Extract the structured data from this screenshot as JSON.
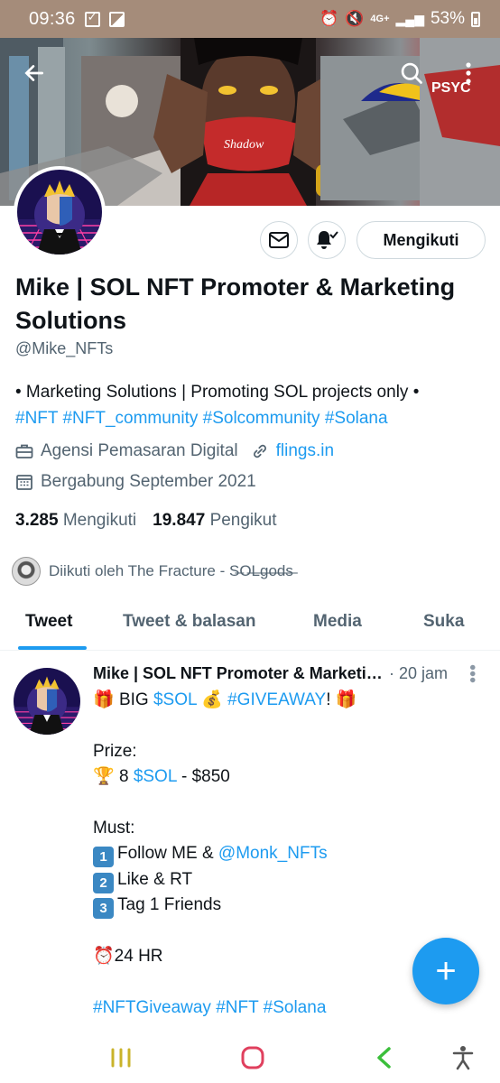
{
  "status_bar": {
    "time": "09:36",
    "network": "4G+",
    "battery": "53%"
  },
  "header": {
    "back_icon": "arrow-left-icon",
    "search_icon": "search-icon",
    "more_icon": "more-vertical-icon"
  },
  "profile": {
    "name": "Mike | SOL NFT Promoter & Marketing Solutions",
    "handle": "@Mike_NFTs",
    "follow_label": "Mengikuti",
    "bio_line1": "• Marketing Solutions | Promoting SOL projects only •",
    "bio_tags": [
      "#NFT",
      "#NFT_community",
      "#Solcommunity",
      "#Solana"
    ],
    "category": "Agensi Pemasaran Digital",
    "website": "flings.in",
    "joined": "Bergabung September 2021",
    "following_count": "3.285",
    "following_label": "Mengikuti",
    "followers_count": "19.847",
    "followers_label": "Pengikut",
    "followed_by": "Diikuti oleh The Fracture - S̶O̶L̶g̶o̶d̶s̶"
  },
  "tabs": [
    {
      "label": "Tweet",
      "active": true
    },
    {
      "label": "Tweet & balasan",
      "active": false
    },
    {
      "label": "Media",
      "active": false
    },
    {
      "label": "Suka",
      "active": false
    }
  ],
  "tweet": {
    "author": "Mike | SOL NFT Promoter & Marketing Solutions",
    "time": "· 20 jam",
    "line1_pre": "BIG",
    "line1_sol": "$SOL",
    "line1_tag": "#GIVEAWAY",
    "line1_post": "!",
    "prize_label": "Prize:",
    "prize_pre": "8",
    "prize_sol": "$SOL",
    "prize_post": "- $850",
    "must_label": "Must:",
    "step1_pre": "Follow ME &",
    "step1_mention": "@Monk_NFTs",
    "step2": "Like & RT",
    "step3": "Tag 1 Friends",
    "duration": "24 HR",
    "tags": [
      "#NFTGiveaway",
      "#NFT",
      "#Solana"
    ]
  },
  "fab": {
    "label": "+"
  },
  "colors": {
    "accent": "#1d9bf0",
    "text": "#0f1419",
    "secondary": "#536471",
    "status_bar": "#a58c7a"
  }
}
